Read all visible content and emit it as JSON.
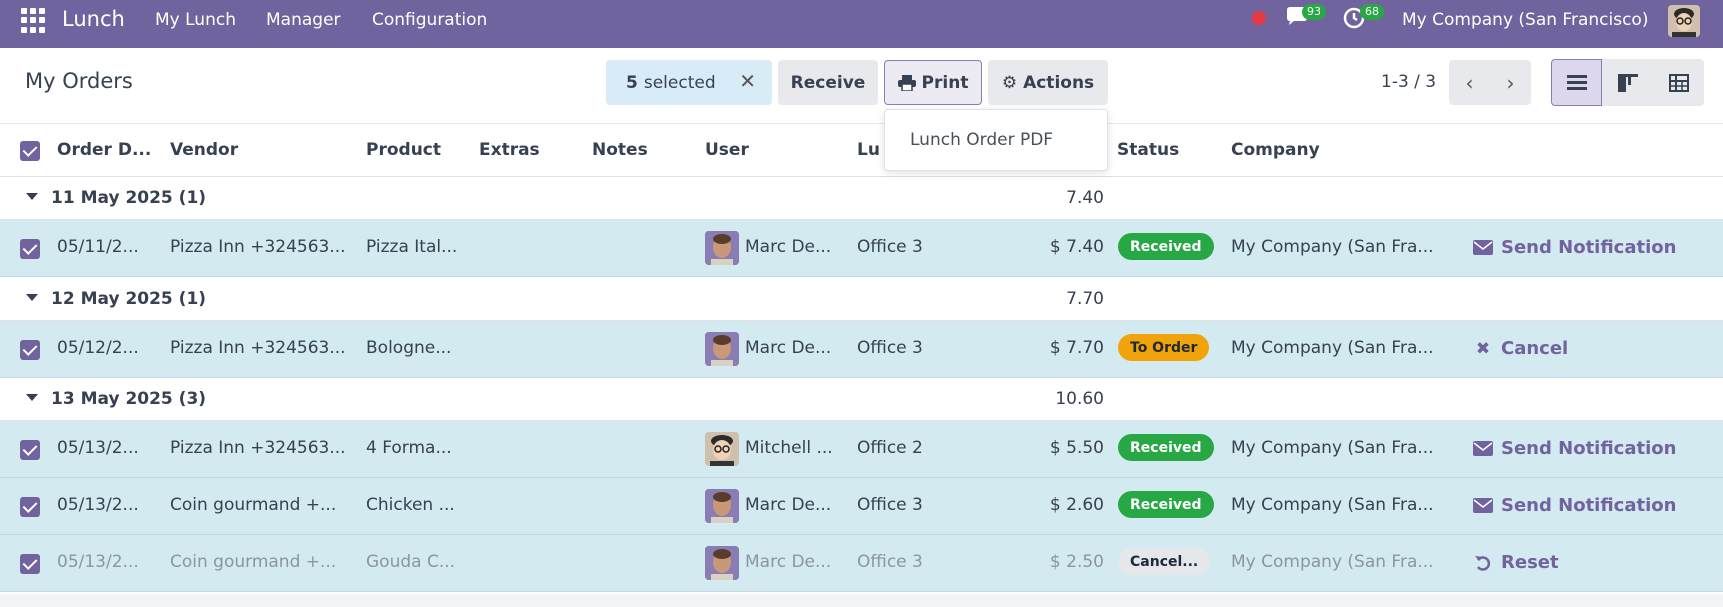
{
  "navbar": {
    "brand": "Lunch",
    "menu": [
      "My Lunch",
      "Manager",
      "Configuration"
    ],
    "chat_count": "93",
    "activity_count": "68",
    "company": "My Company (San Francisco)"
  },
  "control": {
    "title": "My Orders",
    "selected_count": "5",
    "selected_label": "selected",
    "receive": "Receive",
    "print": "Print",
    "actions": "Actions",
    "pager": "1-3 / 3"
  },
  "dropdown": {
    "item": "Lunch Order PDF"
  },
  "columns": [
    "Order D...",
    "Vendor",
    "Product",
    "Extras",
    "Notes",
    "User",
    "Lu",
    "Status",
    "Company"
  ],
  "groups": [
    {
      "label": "11 May 2025 (1)",
      "total": "7.40"
    },
    {
      "label": "12 May 2025 (1)",
      "total": "7.70"
    },
    {
      "label": "13 May 2025 (3)",
      "total": "10.60"
    }
  ],
  "rows": [
    {
      "date": "05/11/2...",
      "vendor": "Pizza Inn +324563...",
      "product": "Pizza Ital...",
      "user": "Marc De...",
      "location": "Office 3",
      "price": "$ 7.40",
      "status": "Received",
      "company": "My Company (San Fra...",
      "action": "Send Notification"
    },
    {
      "date": "05/12/2...",
      "vendor": "Pizza Inn +324563...",
      "product": "Bologne...",
      "user": "Marc De...",
      "location": "Office 3",
      "price": "$ 7.70",
      "status": "To Order",
      "company": "My Company (San Fra...",
      "action": "Cancel"
    },
    {
      "date": "05/13/2...",
      "vendor": "Pizza Inn +324563...",
      "product": "4 Forma...",
      "user": "Mitchell ...",
      "location": "Office 2",
      "price": "$ 5.50",
      "status": "Received",
      "company": "My Company (San Fra...",
      "action": "Send Notification"
    },
    {
      "date": "05/13/2...",
      "vendor": "Coin gourmand +...",
      "product": "Chicken ...",
      "user": "Marc De...",
      "location": "Office 3",
      "price": "$ 2.60",
      "status": "Received",
      "company": "My Company (San Fra...",
      "action": "Send Notification"
    },
    {
      "date": "05/13/2...",
      "vendor": "Coin gourmand +...",
      "product": "Gouda C...",
      "user": "Marc De...",
      "location": "Office 3",
      "price": "$ 2.50",
      "status": "Cancel...",
      "company": "My Company (San Fra...",
      "action": "Reset"
    }
  ],
  "colors": {
    "brand": "#71639e",
    "selected_row": "#d3eaf0",
    "received": "#28a745",
    "to_order": "#f0a30a"
  }
}
